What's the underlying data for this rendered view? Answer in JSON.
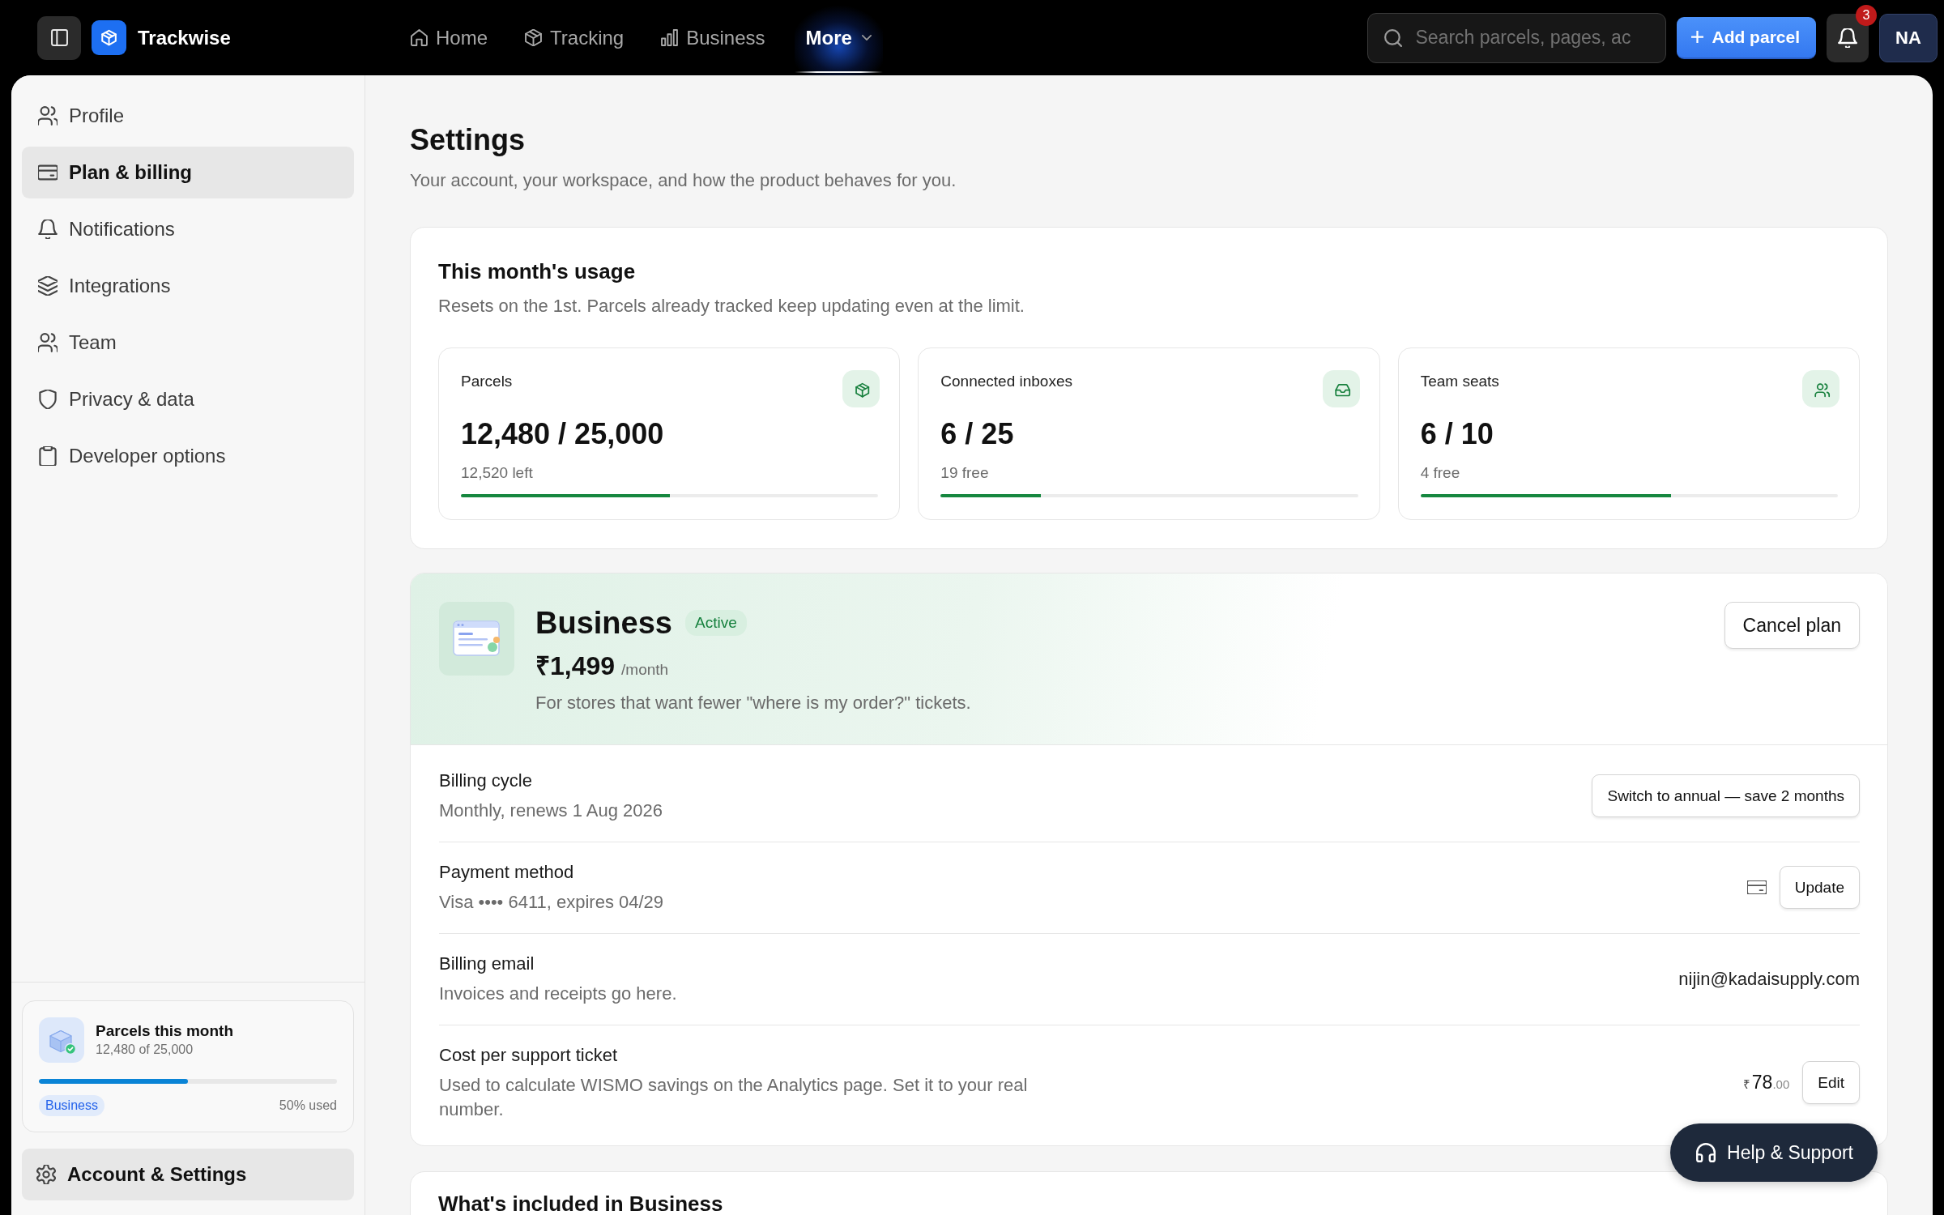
{
  "topbar": {
    "brand": "Trackwise",
    "nav": [
      {
        "label": "Home",
        "kind": "link",
        "selected": false
      },
      {
        "label": "Tracking",
        "kind": "link",
        "selected": false
      },
      {
        "label": "Business",
        "kind": "link",
        "selected": false
      },
      {
        "label": "More",
        "kind": "dropdown",
        "selected": true
      }
    ],
    "search": {
      "placeholder": "Search parcels, pages, ac"
    },
    "add_button": "Add parcel",
    "notification_count": "3",
    "avatar": "NA"
  },
  "sidebar": {
    "items": [
      {
        "label": "Profile",
        "selected": false
      },
      {
        "label": "Plan & billing",
        "selected": true
      },
      {
        "label": "Notifications",
        "selected": false
      },
      {
        "label": "Integrations",
        "selected": false
      },
      {
        "label": "Team",
        "selected": false
      },
      {
        "label": "Privacy & data",
        "selected": false
      },
      {
        "label": "Developer options",
        "selected": false
      }
    ],
    "usage_card": {
      "title": "Parcels this month",
      "subtitle": "12,480 of 25,000",
      "level": 0.5,
      "plan": "Business",
      "reading": "50% used"
    },
    "footer_button": "Account & Settings"
  },
  "page": {
    "title": "Settings",
    "subtitle": "Your account, your workspace, and how the product behaves for you."
  },
  "usage": {
    "title": "This month's usage",
    "subtitle": "Resets on the 1st. Parcels already tracked keep updating even at the limit.",
    "stats": [
      {
        "label": "Parcels",
        "value": "12,480 / 25,000",
        "note": "12,520 left",
        "level": 0.5
      },
      {
        "label": "Connected inboxes",
        "value": "6 / 25",
        "note": "19 free",
        "level": 0.24
      },
      {
        "label": "Team seats",
        "value": "6 / 10",
        "note": "4 free",
        "level": 0.6
      }
    ]
  },
  "plan": {
    "name": "Business",
    "status": "Active",
    "price": "₹1,499",
    "period": "/month",
    "description": "For stores that want fewer \"where is my order?\" tickets.",
    "cancel_button": "Cancel plan",
    "rows": [
      {
        "kind": "button",
        "label": "Billing cycle",
        "detail": "Monthly, renews 1 Aug 2026",
        "action": "Switch to annual — save 2 months"
      },
      {
        "kind": "card_button",
        "label": "Payment method",
        "detail": "Visa •••• 6411, expires 04/29",
        "action": "Update"
      },
      {
        "kind": "text",
        "label": "Billing email",
        "detail": "Invoices and receipts go here.",
        "value": "nijin@kadaisupply.com"
      },
      {
        "kind": "amount",
        "label": "Cost per support ticket",
        "detail": "Used to calculate WISMO savings on the Analytics page. Set it to your real number.",
        "currency": "₹",
        "amount": "78",
        "decimals": ".00",
        "action": "Edit"
      }
    ]
  },
  "included": {
    "title": "What's included in Business"
  },
  "help_button": "Help & Support"
}
